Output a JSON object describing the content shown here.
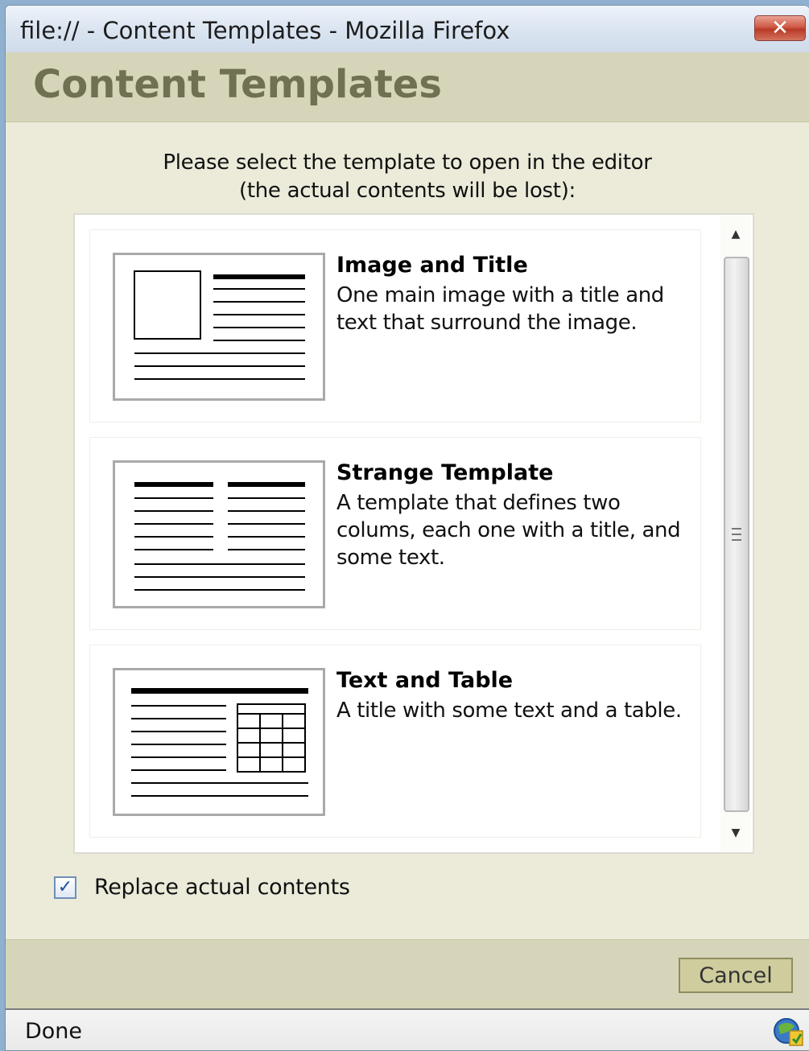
{
  "window": {
    "title": "file:// - Content Templates - Mozilla Firefox",
    "close_label": "✕"
  },
  "dialog": {
    "heading": "Content Templates",
    "instructions_line1": "Please select the template to open in the editor",
    "instructions_line2": "(the actual contents will be lost):"
  },
  "templates": [
    {
      "title": "Image and Title",
      "description": "One main image with a title and text that surround the image.",
      "thumbnail_icon": "image-and-title-thumbnail"
    },
    {
      "title": "Strange Template",
      "description": "A template that defines two colums, each one with a title, and some text.",
      "thumbnail_icon": "two-columns-thumbnail"
    },
    {
      "title": "Text and Table",
      "description": "A title with some text and a table.",
      "thumbnail_icon": "text-and-table-thumbnail"
    }
  ],
  "options": {
    "replace_label": "Replace actual contents",
    "replace_checked": true
  },
  "footer": {
    "cancel_label": "Cancel"
  },
  "status": {
    "text": "Done"
  },
  "colors": {
    "accent": "#707052",
    "header_bg": "#d6d5ba",
    "body_bg": "#ecebda"
  }
}
